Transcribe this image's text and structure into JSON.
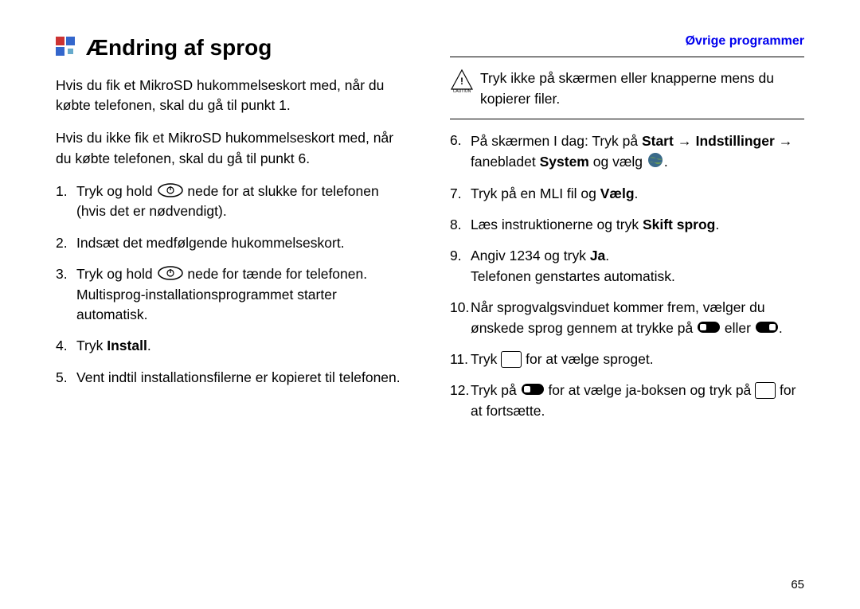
{
  "header": {
    "link": "Øvrige programmer"
  },
  "title": "Ændring af sprog",
  "intro1": "Hvis du fik et MikroSD hukommelseskort med, når du købte telefonen, skal du gå til punkt 1.",
  "intro2": "Hvis du ikke fik et MikroSD hukommelseskort med, når du købte telefonen, skal du gå til punkt 6.",
  "steps": {
    "s1a": "Tryk og hold ",
    "s1b": " nede for at slukke for telefonen (hvis det er nødvendigt).",
    "s2": "Indsæt det medfølgende hukommelseskort.",
    "s3a": "Tryk og hold ",
    "s3b": " nede for tænde for telefonen.",
    "s3c": "Multisprog-installationsprogrammet starter automatisk.",
    "s4a": "Tryk ",
    "s4b": "Install",
    "s4c": ".",
    "s5": "Vent indtil installationsfilerne er kopieret til telefonen.",
    "caution": "Tryk ikke på skærmen eller knapperne mens du kopierer filer.",
    "s6a": "På skærmen I dag: Tryk på ",
    "s6b": "Start",
    "s6c": "Indstillinger",
    "s6d": " fanebladet ",
    "s6e": "System",
    "s6f": " og vælg ",
    "s6g": ".",
    "s7a": "Tryk på en MLI fil og ",
    "s7b": "Vælg",
    "s7c": ".",
    "s8a": "Læs instruktionerne og tryk ",
    "s8b": "Skift sprog",
    "s8c": ".",
    "s9a": "Angiv 1234 og tryk ",
    "s9b": "Ja",
    "s9c": ".",
    "s9d": "Telefonen genstartes automatisk.",
    "s10a": "Når sprogvalgsvinduet kommer frem, vælger du ønskede sprog gennem at trykke på ",
    "s10b": " eller ",
    "s10c": ".",
    "s11a": "Tryk ",
    "s11b": " for at vælge sproget.",
    "s12a": "Tryk på ",
    "s12b": " for at vælge ja-boksen og tryk på ",
    "s12c": " for at fortsætte."
  },
  "pageNumber": "65"
}
